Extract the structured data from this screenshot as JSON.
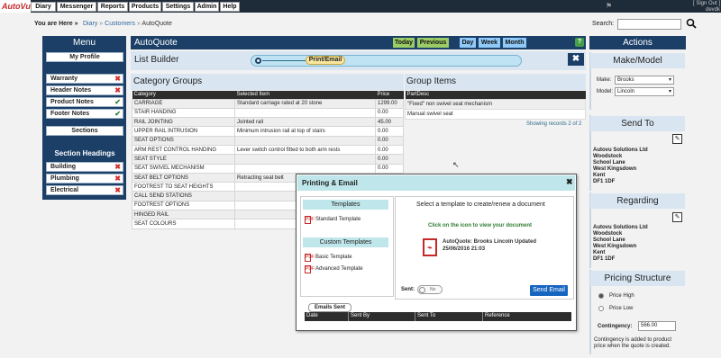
{
  "app": {
    "logo_text": "AutoVu"
  },
  "nav": [
    "Diary",
    "Messenger",
    "Reports",
    "Products",
    "Settings",
    "Admin",
    "Help"
  ],
  "user": {
    "signout": "[ Sign Out ]",
    "name": "devdk"
  },
  "breadcrumb": {
    "you_are_here": "You are Here »",
    "items": [
      "Diary",
      "Customers",
      "AutoQuote"
    ],
    "separator": "»"
  },
  "search": {
    "label": "Search:",
    "value": ""
  },
  "menu": {
    "title": "Menu",
    "profile": "My Profile",
    "items": [
      {
        "label": "Warranty",
        "status": "x"
      },
      {
        "label": "Header Notes",
        "status": "x"
      },
      {
        "label": "Product Notes",
        "status": "ok"
      },
      {
        "label": "Footer Notes",
        "status": "ok"
      }
    ],
    "sections": "Sections",
    "section_headings": "Section Headings",
    "section_items": [
      {
        "label": "Building",
        "status": "x"
      },
      {
        "label": "Plumbing",
        "status": "x"
      },
      {
        "label": "Electrical",
        "status": "x"
      }
    ]
  },
  "autoquote": {
    "title": "AutoQuote",
    "buttons": {
      "today": "Today",
      "previous": "Previous",
      "day": "Day",
      "week": "Week",
      "month": "Month"
    },
    "help": "?"
  },
  "list_builder": {
    "title": "List Builder",
    "step": "Print/Email",
    "close": "✖"
  },
  "category_groups": {
    "title": "Category Groups",
    "columns": [
      "Category",
      "Selected Item",
      "Price"
    ],
    "rows": [
      [
        "CARRIAGE",
        "Standard carriage rated at 20 stone",
        "1299.00"
      ],
      [
        "STAIR HANDING",
        "",
        "0.00"
      ],
      [
        "RAIL JOINTING",
        "Jointed rail",
        "45.00"
      ],
      [
        "UPPER RAIL INTRUSION",
        "Minimum intrusion rail at top of stairs",
        "0.00"
      ],
      [
        "SEAT OPTIONS",
        "",
        "0.00"
      ],
      [
        "ARM REST CONTROL HANDING",
        "Lever switch control fitted to both arm rests",
        "0.00"
      ],
      [
        "SEAT STYLE",
        "",
        "0.00"
      ],
      [
        "SEAT SWIVEL MECHANISM",
        "",
        "0.00"
      ],
      [
        "SEAT BELT OPTIONS",
        "Retracting seat belt",
        "0.00"
      ],
      [
        "FOOTREST TO SEAT HEIGHTS",
        "",
        "0.00"
      ],
      [
        "CALL SEND STATIONS",
        "",
        "0.00"
      ],
      [
        "FOOTREST OPTIONS",
        "",
        "0.00"
      ],
      [
        "HINGED RAIL",
        "",
        "0.00"
      ],
      [
        "SEAT COLOURS",
        "",
        "0.00"
      ]
    ]
  },
  "group_items": {
    "title": "Group Items",
    "columns": [
      "PartDesc"
    ],
    "rows": [
      "\"Fixed\" non swivel seat mechanism",
      "Manual swivel seat"
    ],
    "showing": "Showing records 2 of 2"
  },
  "actions": {
    "title": "Actions"
  },
  "make_model": {
    "title": "Make/Model",
    "make_label": "Make:",
    "make_value": "Brooks",
    "model_label": "Model:",
    "model_value": "Lincoln"
  },
  "send_to": {
    "title": "Send To",
    "address": [
      "Autovu Solutions Ltd",
      "Woodstock",
      "School Lane",
      "West Kingsdown",
      "Kent",
      "DF1 1DF"
    ]
  },
  "regarding": {
    "title": "Regarding",
    "address": [
      "Autovu Solutions Ltd",
      "Woodstock",
      "School Lane",
      "West Kingsdown",
      "Kent",
      "DF1 1DF"
    ]
  },
  "pricing": {
    "title": "Pricing Structure",
    "options": [
      "Price High",
      "Price Low"
    ],
    "selected": "Price High",
    "contingency_label": "Contingency:",
    "contingency_value": "566.00",
    "note": "Contingency is added to product price when the quote is created."
  },
  "modal": {
    "title": "Printing & Email",
    "close": "✖",
    "templates_head": "Templates",
    "templates": [
      "Standard Template"
    ],
    "custom_head": "Custom Templates",
    "custom_templates": [
      "Basic Template",
      "Advanced Template"
    ],
    "select_msg": "Select a template to create/renew a document",
    "click_msg": "Click on the icon to view your document",
    "doc_title": "AutoQuote: Brooks Lincoln Updated",
    "doc_date": "25/06/2016 21:03",
    "sent_label": "Sent:",
    "sent_toggle": "No",
    "send_button": "Send Email",
    "emails_sent": "Emails Sent",
    "email_columns": [
      "Date",
      "Sent By",
      "Sent To",
      "Reference"
    ]
  },
  "colors": {
    "navy": "#1b3f67",
    "panel": "#d9e6f2",
    "accent_green": "#9ccc65",
    "accent_blue": "#90caf9",
    "send_blue": "#1565c0"
  }
}
